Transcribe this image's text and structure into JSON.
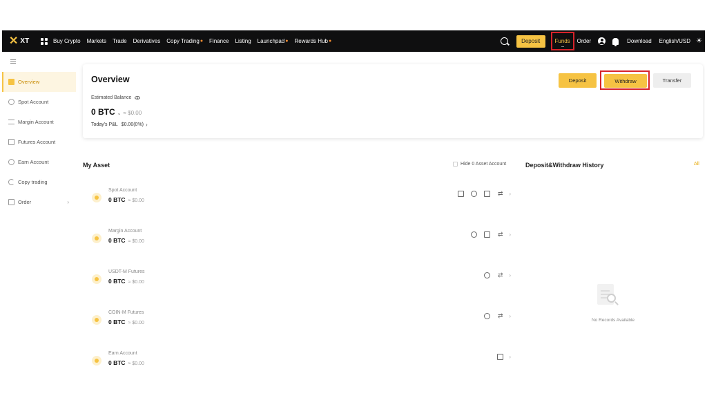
{
  "brand": {
    "logo_text": "XT"
  },
  "topnav": {
    "items": [
      {
        "label": "Buy Crypto",
        "hot": false
      },
      {
        "label": "Markets",
        "hot": false
      },
      {
        "label": "Trade",
        "hot": false
      },
      {
        "label": "Derivatives",
        "hot": false
      },
      {
        "label": "Copy Trading",
        "hot": true
      },
      {
        "label": "Finance",
        "hot": false
      },
      {
        "label": "Listing",
        "hot": false
      },
      {
        "label": "Launchpad",
        "hot": true
      },
      {
        "label": "Rewards Hub",
        "hot": true
      }
    ],
    "deposit_label": "Deposit",
    "funds_label": "Funds",
    "order_label": "Order",
    "download_label": "Download",
    "lang_label": "English/USD"
  },
  "sidebar": {
    "items": [
      {
        "label": "Overview",
        "icon": "overview-icon",
        "active": true
      },
      {
        "label": "Spot Account",
        "icon": "spot-icon",
        "active": false
      },
      {
        "label": "Margin Account",
        "icon": "margin-icon",
        "active": false
      },
      {
        "label": "Futures Account",
        "icon": "futures-icon",
        "active": false
      },
      {
        "label": "Earn Account",
        "icon": "earn-icon",
        "active": false
      },
      {
        "label": "Copy trading",
        "icon": "copy-icon",
        "active": false
      },
      {
        "label": "Order",
        "icon": "order-icon",
        "active": false
      }
    ]
  },
  "overview": {
    "title": "Overview",
    "estimated_label": "Estimated Balance",
    "balance": "0 BTC",
    "balance_usd": "≈ $0.00",
    "pnl_label": "Today's P&L",
    "pnl_value": "$0.00(0%)",
    "deposit_label": "Deposit",
    "withdraw_label": "Withdraw",
    "transfer_label": "Transfer"
  },
  "my_asset": {
    "title": "My Asset",
    "hide_zero_label": "Hide 0 Asset Account",
    "accounts": [
      {
        "name": "Spot Account",
        "balance": "0 BTC",
        "usd": "≈ $0.00"
      },
      {
        "name": "Margin Account",
        "balance": "0 BTC",
        "usd": "≈ $0.00"
      },
      {
        "name": "USDT-M Futures",
        "balance": "0 BTC",
        "usd": "≈ $0.00"
      },
      {
        "name": "COIN-M Futures",
        "balance": "0 BTC",
        "usd": "≈ $0.00"
      },
      {
        "name": "Earn Account",
        "balance": "0 BTC",
        "usd": "≈ $0.00"
      }
    ]
  },
  "history": {
    "title": "Deposit&Withdraw History",
    "all_label": "All",
    "empty_text": "No Records Available"
  },
  "colors": {
    "accent": "#f6c343",
    "nav_bg": "#0f0f10",
    "highlight_border": "#d7232a"
  }
}
